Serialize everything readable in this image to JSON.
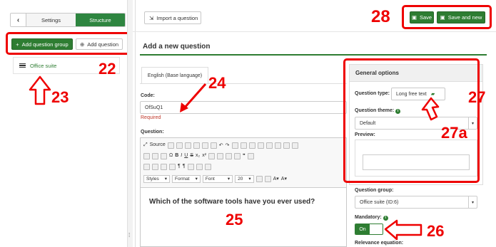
{
  "sidebar": {
    "back_icon": "chevron-left-icon",
    "tab_settings": "Settings",
    "tab_structure": "Structure",
    "add_group_label": "Add question group",
    "add_question_label": "Add question",
    "group_name": "Office suite"
  },
  "toolbar": {
    "import_label": "Import a question",
    "save_label": "Save",
    "save_new_label": "Save and new"
  },
  "form": {
    "heading": "Add a new question",
    "language_tab": "English (Base language)",
    "code_label": "Code:",
    "code_value": "OfSuQ1",
    "required_text": "Required",
    "question_label": "Question:",
    "question_text": "Which of the software tools have you ever used?"
  },
  "editor": {
    "source_label": "Source",
    "styles_label": "Styles",
    "format_label": "Format",
    "font_label": "Font",
    "size_value": "20",
    "bold": "B",
    "italic": "I",
    "underline": "U",
    "strike": "S"
  },
  "options": {
    "title": "General options",
    "qtype_label": "Question type:",
    "qtype_value": "Long free text",
    "theme_label": "Question theme:",
    "theme_value": "Default",
    "preview_label": "Preview:",
    "group_label": "Question group:",
    "group_value": "Office suite (ID:6)",
    "mandatory_label": "Mandatory:",
    "mandatory_value": "On",
    "relevance_label": "Relevance equation:"
  },
  "annotations": {
    "n22": "22",
    "n23": "23",
    "n24": "24",
    "n25": "25",
    "n26": "26",
    "n27": "27",
    "n27a": "27a",
    "n28": "28"
  },
  "colors": {
    "accent": "#2e7d32",
    "annotation": "#e00000"
  }
}
